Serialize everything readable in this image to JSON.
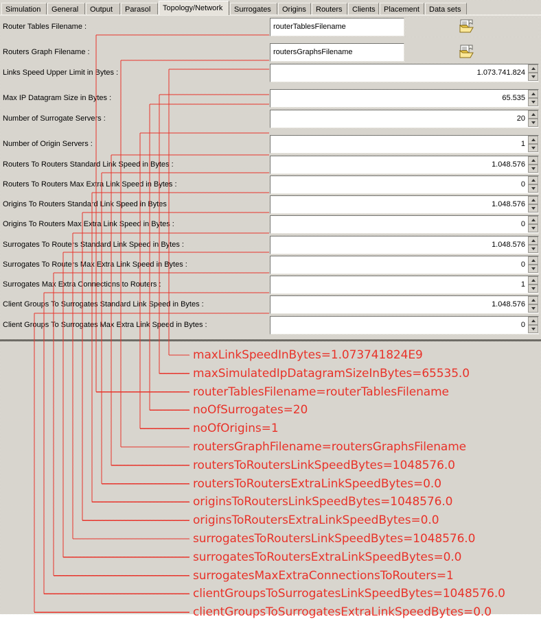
{
  "window": {
    "tabs": [
      {
        "label": "Simulation",
        "active": false
      },
      {
        "label": "General",
        "active": false
      },
      {
        "label": "Output",
        "active": false
      },
      {
        "label": "Parasol",
        "active": false
      },
      {
        "label": "Topology/Network",
        "active": true
      },
      {
        "label": "Surrogates",
        "active": false
      },
      {
        "label": "Origins",
        "active": false
      },
      {
        "label": "Routers",
        "active": false
      },
      {
        "label": "Clients",
        "active": false
      },
      {
        "label": "Placement",
        "active": false
      },
      {
        "label": "Data sets",
        "active": false
      }
    ]
  },
  "form": {
    "rows": [
      {
        "label": "Router Tables Filename :",
        "type": "text",
        "value": "routerTablesFilename",
        "browse_icon": "open-document-icon"
      },
      {
        "label": "Routers Graph Filename :",
        "type": "text",
        "value": "routersGraphsFilename",
        "browse_icon": "open-document-icon"
      },
      {
        "label": "Links Speed Upper Limit in Bytes :",
        "type": "spinner",
        "value": "1.073.741.824"
      },
      {
        "label": "Max IP Datagram Size in Bytes :",
        "type": "spinner",
        "value": "65.535"
      },
      {
        "label": "Number of Surrogate Servers :",
        "type": "spinner",
        "value": "20"
      },
      {
        "label": "Number of Origin Servers :",
        "type": "spinner",
        "value": "1"
      },
      {
        "label": "Routers To Routers Standard Link Speed in Bytes :",
        "type": "spinner",
        "value": "1.048.576"
      },
      {
        "label": "Routers To Routers Max Extra Link Speed in Bytes :",
        "type": "spinner",
        "value": "0"
      },
      {
        "label": "Origins To Routers Standard Link Speed in Bytes",
        "type": "spinner",
        "value": "1.048.576"
      },
      {
        "label": "Origins To Routers Max Extra Link Speed in Bytes :",
        "type": "spinner",
        "value": "0"
      },
      {
        "label": "Surrogates To Routers Standard Link Speed in Bytes :",
        "type": "spinner",
        "value": "1.048.576"
      },
      {
        "label": "Surrogates To Routers Max Extra Link Speed in Bytes :",
        "type": "spinner",
        "value": "0"
      },
      {
        "label": "Surrogates Max Extra Connections to Routers :",
        "type": "spinner",
        "value": "1"
      },
      {
        "label": "Client Groups To Surrogates Standard Link Speed in Bytes :",
        "type": "spinner",
        "value": "1.048.576"
      },
      {
        "label": "Client Groups To Surrogates Max Extra Link Speed in Bytes :",
        "type": "spinner",
        "value": "0"
      }
    ]
  },
  "annotations": {
    "color": "#e8332a",
    "items": [
      {
        "text": "maxLinkSpeedInBytes=1.073741824E9"
      },
      {
        "text": "maxSimulatedIpDatagramSizeInBytes=65535.0"
      },
      {
        "text": "routerTablesFilename=routerTablesFilename"
      },
      {
        "text": "noOfSurrogates=20"
      },
      {
        "text": "noOfOrigins=1"
      },
      {
        "text": "routersGraphFilename=routersGraphsFilename"
      },
      {
        "text": "routersToRoutersLinkSpeedBytes=1048576.0"
      },
      {
        "text": "routersToRoutersExtraLinkSpeedBytes=0.0"
      },
      {
        "text": "originsToRoutersLinkSpeedBytes=1048576.0"
      },
      {
        "text": "originsToRoutersExtraLinkSpeedBytes=0.0"
      },
      {
        "text": "surrogatesToRoutersLinkSpeedBytes=1048576.0"
      },
      {
        "text": "surrogatesToRoutersExtraLinkSpeedBytes=0.0"
      },
      {
        "text": "surrogatesMaxExtraConnectionsToRouters=1"
      },
      {
        "text": "clientGroupsToSurrogatesLinkSpeedBytes=1048576.0"
      },
      {
        "text": "clientGroupsToSurrogatesExtraLinkSpeedBytes=0.0"
      }
    ]
  }
}
